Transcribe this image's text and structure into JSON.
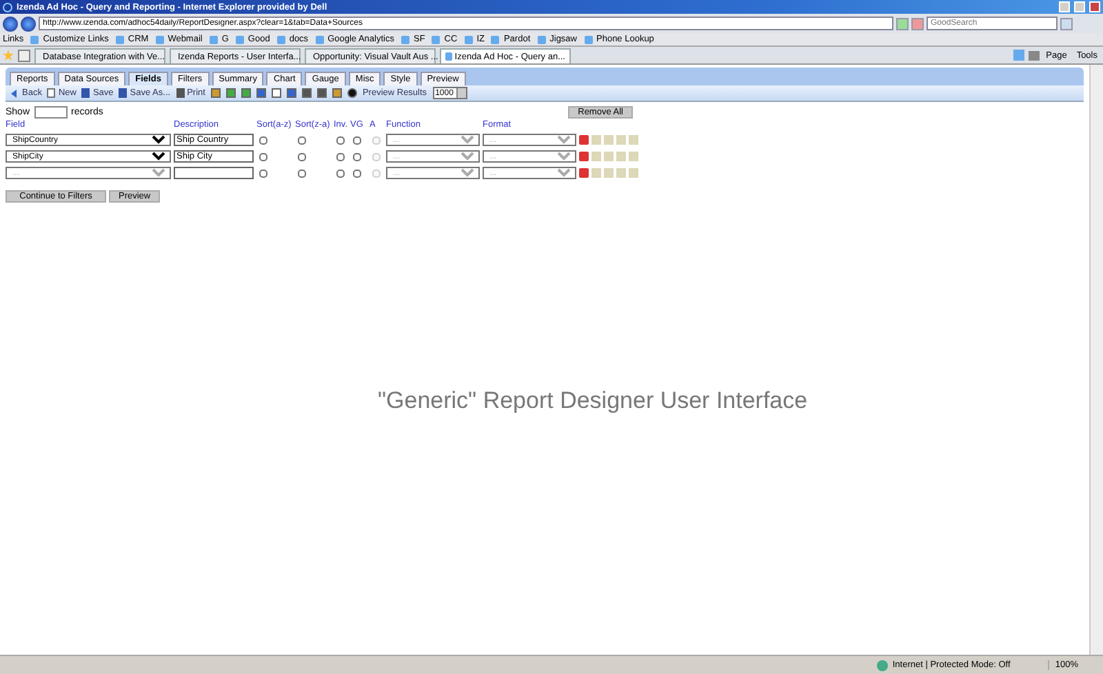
{
  "window": {
    "title": "Izenda Ad Hoc - Query and Reporting - Internet Explorer provided by Dell"
  },
  "address": {
    "value": "http://www.izenda.com/adhoc54daily/ReportDesigner.aspx?clear=1&tab=Data+Sources"
  },
  "search": {
    "placeholder": "GoodSearch"
  },
  "links": {
    "label": "Links",
    "items": [
      "Customize Links",
      "CRM",
      "Webmail",
      "G",
      "Good",
      "docs",
      "Google Analytics",
      "SF",
      "CC",
      "IZ",
      "Pardot",
      "Jigsaw",
      "Phone Lookup"
    ]
  },
  "browser_tabs": [
    {
      "label": "Database Integration with Ve...",
      "selected": false
    },
    {
      "label": "Izenda Reports - User Interfa...",
      "selected": false
    },
    {
      "label": "Opportunity: Visual Vault Aus ...",
      "selected": false
    },
    {
      "label": "Izenda Ad Hoc - Query an...",
      "selected": true
    }
  ],
  "command_bar": [
    "Page",
    "Tools"
  ],
  "app_tabs": [
    {
      "label": "Reports",
      "selected": false
    },
    {
      "label": "Data Sources",
      "selected": false
    },
    {
      "label": "Fields",
      "selected": true
    },
    {
      "label": "Filters",
      "selected": false
    },
    {
      "label": "Summary",
      "selected": false
    },
    {
      "label": "Chart",
      "selected": false
    },
    {
      "label": "Gauge",
      "selected": false
    },
    {
      "label": "Misc",
      "selected": false
    },
    {
      "label": "Style",
      "selected": false
    },
    {
      "label": "Preview",
      "selected": false
    }
  ],
  "toolbar": {
    "back": "Back",
    "new": "New",
    "save": "Save",
    "save_as": "Save As...",
    "print": "Print",
    "preview_results": "Preview Results",
    "preview_count": "1000"
  },
  "show": {
    "label": "Show",
    "suffix": "records"
  },
  "remove_all": "Remove All",
  "columns": [
    "Field",
    "Description",
    "Sort(a-z)",
    "Sort(z-a)",
    "Inv.",
    "VG",
    "A",
    "Function",
    "Format"
  ],
  "rows": [
    {
      "field": "ShipCountry",
      "description": "Ship Country",
      "sort_az": false,
      "sort_za": false,
      "inv": false,
      "vg": false,
      "a_disabled": true,
      "function": "...",
      "format": "..."
    },
    {
      "field": "ShipCity",
      "description": "Ship City",
      "sort_az": false,
      "sort_za": false,
      "inv": false,
      "vg": false,
      "a_disabled": true,
      "function": "...",
      "format": "..."
    },
    {
      "field": "...",
      "description": "",
      "sort_az": false,
      "sort_za": false,
      "inv": false,
      "vg": false,
      "a_disabled": true,
      "function": "...",
      "format": "..."
    }
  ],
  "buttons": [
    "Continue to Filters",
    "Preview"
  ],
  "caption": "\"Generic\" Report Designer User Interface",
  "status_bar": {
    "zone": "Internet | Protected Mode: Off",
    "zoom": "100%"
  }
}
